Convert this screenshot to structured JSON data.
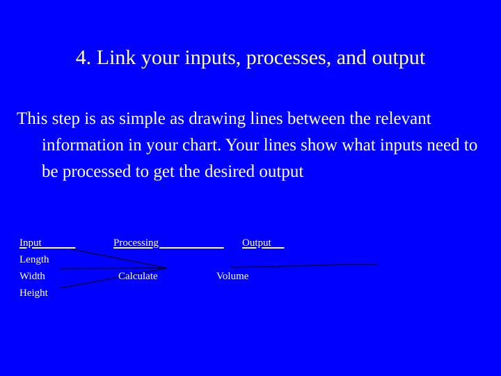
{
  "slide": {
    "background_color": "#0000ff",
    "title": "4. Link your inputs, processes, and output",
    "title_color": "#ffff99",
    "body_color": "#ffffff",
    "body_text": "This step is as simple as drawing lines between the relevant information in your chart.  Your lines show what inputs need to be processed to get the desired output"
  },
  "diagram": {
    "line_color": "#000033",
    "headers": {
      "input": "Input             ",
      "processing": "Processing                         ",
      "output": "Output     "
    },
    "inputs": [
      "Length",
      "Width",
      "Height"
    ],
    "processing": [
      "Calculate"
    ],
    "outputs": [
      "Volume"
    ]
  }
}
